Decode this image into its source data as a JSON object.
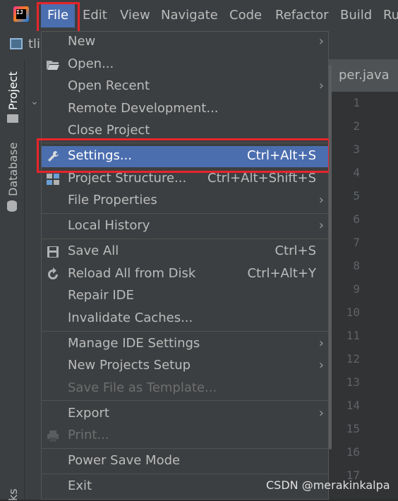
{
  "menubar": {
    "items": [
      "File",
      "Edit",
      "View",
      "Navigate",
      "Code",
      "Refactor",
      "Build",
      "Ru"
    ]
  },
  "toolbar": {
    "project_tab_label": "tli"
  },
  "left_tool_windows": [
    "Project",
    "Database",
    "ks"
  ],
  "editor": {
    "tab_label": "per.java",
    "line_numbers": [
      "1",
      "2",
      "3",
      "4",
      "5",
      "6",
      "7",
      "8",
      "9",
      "10",
      "11",
      "12",
      "13",
      "14",
      "15",
      "16",
      "17"
    ]
  },
  "file_menu": {
    "items": [
      {
        "label": "New",
        "shortcut": "",
        "submenu": true,
        "icon": ""
      },
      {
        "label": "Open...",
        "shortcut": "",
        "submenu": false,
        "icon": "folder-open-icon"
      },
      {
        "label": "Open Recent",
        "shortcut": "",
        "submenu": true,
        "icon": ""
      },
      {
        "label": "Remote Development...",
        "shortcut": "",
        "submenu": false,
        "icon": ""
      },
      {
        "label": "Close Project",
        "shortcut": "",
        "submenu": false,
        "icon": ""
      },
      {
        "label": "Settings...",
        "shortcut": "Ctrl+Alt+S",
        "submenu": false,
        "icon": "wrench-icon",
        "selected": true
      },
      {
        "label": "Project Structure...",
        "shortcut": "Ctrl+Alt+Shift+S",
        "submenu": false,
        "icon": "project-structure-icon"
      },
      {
        "label": "File Properties",
        "shortcut": "",
        "submenu": true,
        "icon": ""
      },
      {
        "label": "Local History",
        "shortcut": "",
        "submenu": true,
        "icon": ""
      },
      {
        "label": "Save All",
        "shortcut": "Ctrl+S",
        "submenu": false,
        "icon": "save-icon"
      },
      {
        "label": "Reload All from Disk",
        "shortcut": "Ctrl+Alt+Y",
        "submenu": false,
        "icon": "reload-icon"
      },
      {
        "label": "Repair IDE",
        "shortcut": "",
        "submenu": false,
        "icon": ""
      },
      {
        "label": "Invalidate Caches...",
        "shortcut": "",
        "submenu": false,
        "icon": ""
      },
      {
        "label": "Manage IDE Settings",
        "shortcut": "",
        "submenu": true,
        "icon": ""
      },
      {
        "label": "New Projects Setup",
        "shortcut": "",
        "submenu": true,
        "icon": ""
      },
      {
        "label": "Save File as Template...",
        "shortcut": "",
        "submenu": false,
        "icon": "",
        "disabled": true
      },
      {
        "label": "Export",
        "shortcut": "",
        "submenu": true,
        "icon": ""
      },
      {
        "label": "Print...",
        "shortcut": "",
        "submenu": false,
        "icon": "printer-icon",
        "disabled": true
      },
      {
        "label": "Power Save Mode",
        "shortcut": "",
        "submenu": false,
        "icon": ""
      },
      {
        "label": "Exit",
        "shortcut": "",
        "submenu": false,
        "icon": ""
      }
    ]
  },
  "watermark": "CSDN @merakinkalpa",
  "colors": {
    "selection": "#4b6eaf",
    "highlight_box": "#e8242b",
    "menu_bg": "#3c3f41"
  }
}
